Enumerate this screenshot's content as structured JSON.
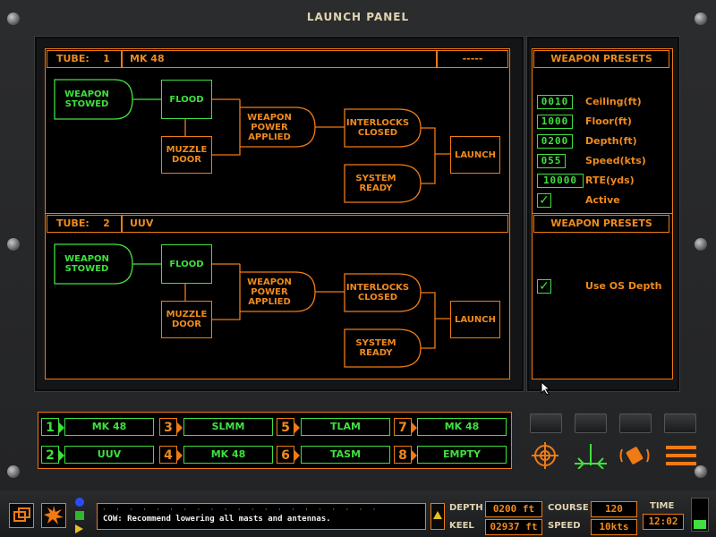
{
  "title": "LAUNCH PANEL",
  "tubes": [
    {
      "tube_label": "TUBE:",
      "tube_number": "1",
      "weapon": "MK 48",
      "status": "-----",
      "nodes": {
        "weapon_stowed": "WEAPON STOWED",
        "flood": "FLOOD",
        "muzzle_door": "MUZZLE DOOR",
        "weapon_power": "WEAPON POWER APPLIED",
        "interlocks": "INTERLOCKS CLOSED",
        "system_ready": "SYSTEM READY",
        "launch": "LAUNCH"
      }
    },
    {
      "tube_label": "TUBE:",
      "tube_number": "2",
      "weapon": "UUV",
      "status": "",
      "nodes": {
        "weapon_stowed": "WEAPON STOWED",
        "flood": "FLOOD",
        "muzzle_door": "MUZZLE DOOR",
        "weapon_power": "WEAPON POWER APPLIED",
        "interlocks": "INTERLOCKS CLOSED",
        "system_ready": "SYSTEM READY",
        "launch": "LAUNCH"
      }
    }
  ],
  "presets1": {
    "header": "WEAPON PRESETS",
    "rows": [
      {
        "value": "0010",
        "label": "Ceiling(ft)"
      },
      {
        "value": "1000",
        "label": "Floor(ft)"
      },
      {
        "value": "0200",
        "label": "Depth(ft)"
      },
      {
        "value": "055",
        "label": "Speed(kts)"
      },
      {
        "value": "10000",
        "label": "RTE(yds)"
      }
    ],
    "active_check": "✓",
    "active_label": "Active"
  },
  "presets2": {
    "header": "WEAPON PRESETS",
    "check": "✓",
    "label": "Use OS Depth"
  },
  "slots": [
    {
      "num": "1",
      "name": "MK 48"
    },
    {
      "num": "3",
      "name": "SLMM"
    },
    {
      "num": "5",
      "name": "TLAM"
    },
    {
      "num": "7",
      "name": "MK 48"
    },
    {
      "num": "2",
      "name": "UUV"
    },
    {
      "num": "4",
      "name": "MK 48"
    },
    {
      "num": "6",
      "name": "TASM"
    },
    {
      "num": "8",
      "name": "EMPTY"
    }
  ],
  "bottom": {
    "message": "COW: Recommend lowering all masts and antennas.",
    "depth_label": "DEPTH",
    "depth_value": "0200 ft",
    "keel_label": "KEEL",
    "keel_value": "02937 ft",
    "course_label": "COURSE",
    "course_value": "120",
    "speed_label": "SPEED",
    "speed_value": "10kts",
    "time_label": "TIME",
    "time_value": "12:02"
  },
  "colors": {
    "accent": "#f07a14",
    "active": "#3fe03f",
    "background": "#000000"
  }
}
